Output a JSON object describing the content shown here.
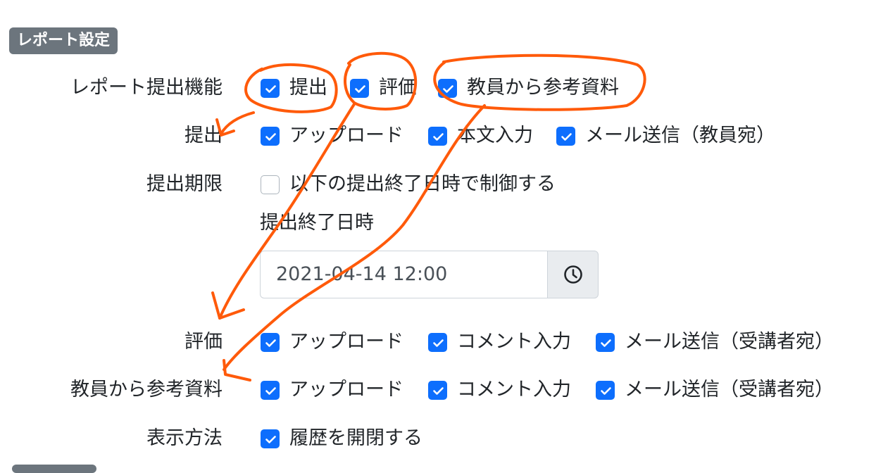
{
  "section_title": "レポート設定",
  "rows": [
    {
      "label": "レポート提出機能",
      "options": [
        {
          "label": "提出",
          "checked": true
        },
        {
          "label": "評価",
          "checked": true
        },
        {
          "label": "教員から参考資料",
          "checked": true
        }
      ]
    },
    {
      "label": "提出",
      "options": [
        {
          "label": "アップロード",
          "checked": true
        },
        {
          "label": "本文入力",
          "checked": true
        },
        {
          "label": "メール送信（教員宛）",
          "checked": true
        }
      ]
    },
    {
      "label": "提出期限",
      "options": [
        {
          "label": "以下の提出終了日時で制御する",
          "checked": false
        }
      ]
    },
    {
      "label": "評価",
      "options": [
        {
          "label": "アップロード",
          "checked": true
        },
        {
          "label": "コメント入力",
          "checked": true
        },
        {
          "label": "メール送信（受講者宛）",
          "checked": true
        }
      ]
    },
    {
      "label": "教員から参考資料",
      "options": [
        {
          "label": "アップロード",
          "checked": true
        },
        {
          "label": "コメント入力",
          "checked": true
        },
        {
          "label": "メール送信（受講者宛）",
          "checked": true
        }
      ]
    },
    {
      "label": "表示方法",
      "options": [
        {
          "label": "履歴を開閉する",
          "checked": true
        }
      ]
    }
  ],
  "deadline": {
    "label": "提出終了日時",
    "value": "2021-04-14 12:00"
  },
  "icons": {
    "picker": "clock-icon",
    "check": "checkmark-icon"
  },
  "colors": {
    "checkbox": "#0d6efd",
    "badge": "#6c757d",
    "annotation": "#ff5a0a"
  }
}
